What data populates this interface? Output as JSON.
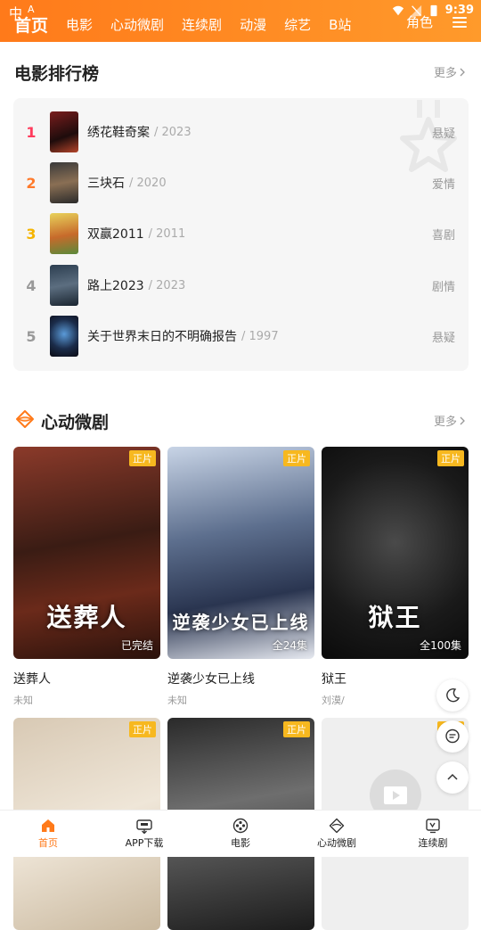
{
  "status": {
    "left_glyph": "中",
    "left_small": "A",
    "time": "9:39"
  },
  "nav": {
    "tabs": [
      "首页",
      "电影",
      "心动微剧",
      "连续剧",
      "动漫",
      "综艺",
      "B站"
    ],
    "extra": "角色"
  },
  "ranking": {
    "title": "电影排行榜",
    "more": "更多",
    "items": [
      {
        "rank": "1",
        "name": "绣花鞋奇案",
        "year": "/ 2023",
        "genre": "悬疑",
        "color": "#ff3b5c"
      },
      {
        "rank": "2",
        "name": "三块石",
        "year": "/ 2020",
        "genre": "爱情",
        "color": "#ff7a2b"
      },
      {
        "rank": "3",
        "name": "双赢2011",
        "year": "/ 2011",
        "genre": "喜剧",
        "color": "#f5b400"
      },
      {
        "rank": "4",
        "name": "路上2023",
        "year": "/ 2023",
        "genre": "剧情",
        "color": "#999999"
      },
      {
        "rank": "5",
        "name": "关于世界末日的不明确报告",
        "year": "/ 1997",
        "genre": "悬疑",
        "color": "#999999"
      }
    ]
  },
  "drama": {
    "title": "心动微剧",
    "more": "更多",
    "cards": [
      {
        "tag": "正片",
        "episodes": "已完结",
        "poster_text": "送葬人",
        "name": "送葬人",
        "sub": "未知"
      },
      {
        "tag": "正片",
        "episodes": "全24集",
        "poster_text": "逆袭少女已上线",
        "name": "逆袭少女已上线",
        "sub": "未知"
      },
      {
        "tag": "正片",
        "episodes": "全100集",
        "poster_text": "狱王",
        "name": "狱王",
        "sub": "刘漠/"
      },
      {
        "tag": "正片",
        "episodes": "",
        "poster_text": "",
        "name": "",
        "sub": ""
      },
      {
        "tag": "正片",
        "episodes": "",
        "poster_text": "",
        "name": "",
        "sub": ""
      },
      {
        "tag": "正片",
        "episodes": "",
        "poster_text": "",
        "name": "",
        "sub": ""
      }
    ]
  },
  "bottom_nav": [
    {
      "label": "首页",
      "icon": "home-icon"
    },
    {
      "label": "APP下载",
      "icon": "app-download-icon"
    },
    {
      "label": "电影",
      "icon": "film-reel-icon"
    },
    {
      "label": "心动微剧",
      "icon": "short-drama-icon"
    },
    {
      "label": "连续剧",
      "icon": "tv-series-icon"
    }
  ],
  "colors": {
    "accent": "#ff7a1a",
    "tag": "#f7b81f"
  }
}
